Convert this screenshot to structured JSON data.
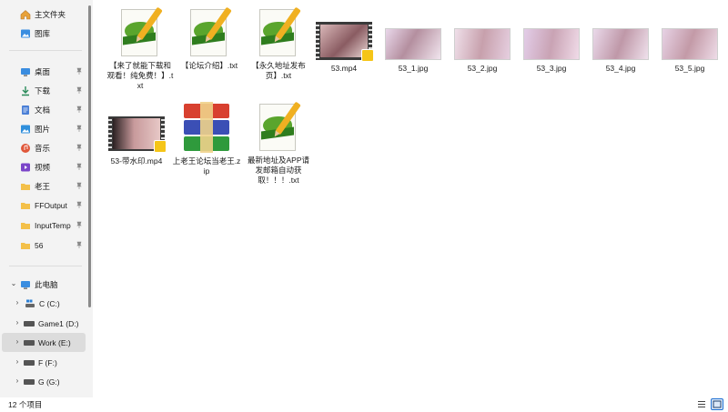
{
  "sidebar": {
    "quick": [
      {
        "label": "主文件夹",
        "icon": "home-icon"
      },
      {
        "label": "图库",
        "icon": "gallery-icon"
      }
    ],
    "pinned": [
      {
        "label": "桌面",
        "icon": "desktop-icon"
      },
      {
        "label": "下载",
        "icon": "download-icon"
      },
      {
        "label": "文档",
        "icon": "document-icon"
      },
      {
        "label": "图片",
        "icon": "pictures-icon"
      },
      {
        "label": "音乐",
        "icon": "music-icon"
      },
      {
        "label": "视频",
        "icon": "videos-icon"
      },
      {
        "label": "老王",
        "icon": "folder-icon"
      },
      {
        "label": "FFOutput",
        "icon": "folder-icon"
      },
      {
        "label": "InputTemp",
        "icon": "folder-icon"
      },
      {
        "label": "56",
        "icon": "folder-icon"
      }
    ],
    "this_pc": {
      "label": "此电脑",
      "icon": "computer-icon"
    },
    "drives": [
      {
        "label": "C (C:)",
        "icon": "drive-c-icon"
      },
      {
        "label": "Game1 (D:)",
        "icon": "drive-icon"
      },
      {
        "label": "Work (E:)",
        "icon": "drive-icon",
        "selected": true
      },
      {
        "label": "F (F:)",
        "icon": "drive-icon"
      },
      {
        "label": "G (G:)",
        "icon": "drive-icon"
      }
    ]
  },
  "files": [
    {
      "name": "【来了就能下载和观看！纯免费！】.txt",
      "type": "txt"
    },
    {
      "name": "【论坛介绍】.txt",
      "type": "txt"
    },
    {
      "name": "【永久地址发布页】.txt",
      "type": "txt"
    },
    {
      "name": "53.mp4",
      "type": "video"
    },
    {
      "name": "53_1.jpg",
      "type": "jpg"
    },
    {
      "name": "53_2.jpg",
      "type": "jpg"
    },
    {
      "name": "53_3.jpg",
      "type": "jpg"
    },
    {
      "name": "53_4.jpg",
      "type": "jpg"
    },
    {
      "name": "53_5.jpg",
      "type": "jpg"
    },
    {
      "name": "53-带水印.mp4",
      "type": "video"
    },
    {
      "name": "上老王论坛当老王.zip",
      "type": "zip"
    },
    {
      "name": "最新地址及APP请发邮箱自动获取！！！.txt",
      "type": "txt"
    }
  ],
  "status": {
    "item_count": "12 个项目"
  },
  "colors": {
    "sidebar_bg": "#f3f3f3",
    "selected_bg": "#dcdcdc",
    "folder": "#f3c04a",
    "accent": "#1f6fd1"
  }
}
